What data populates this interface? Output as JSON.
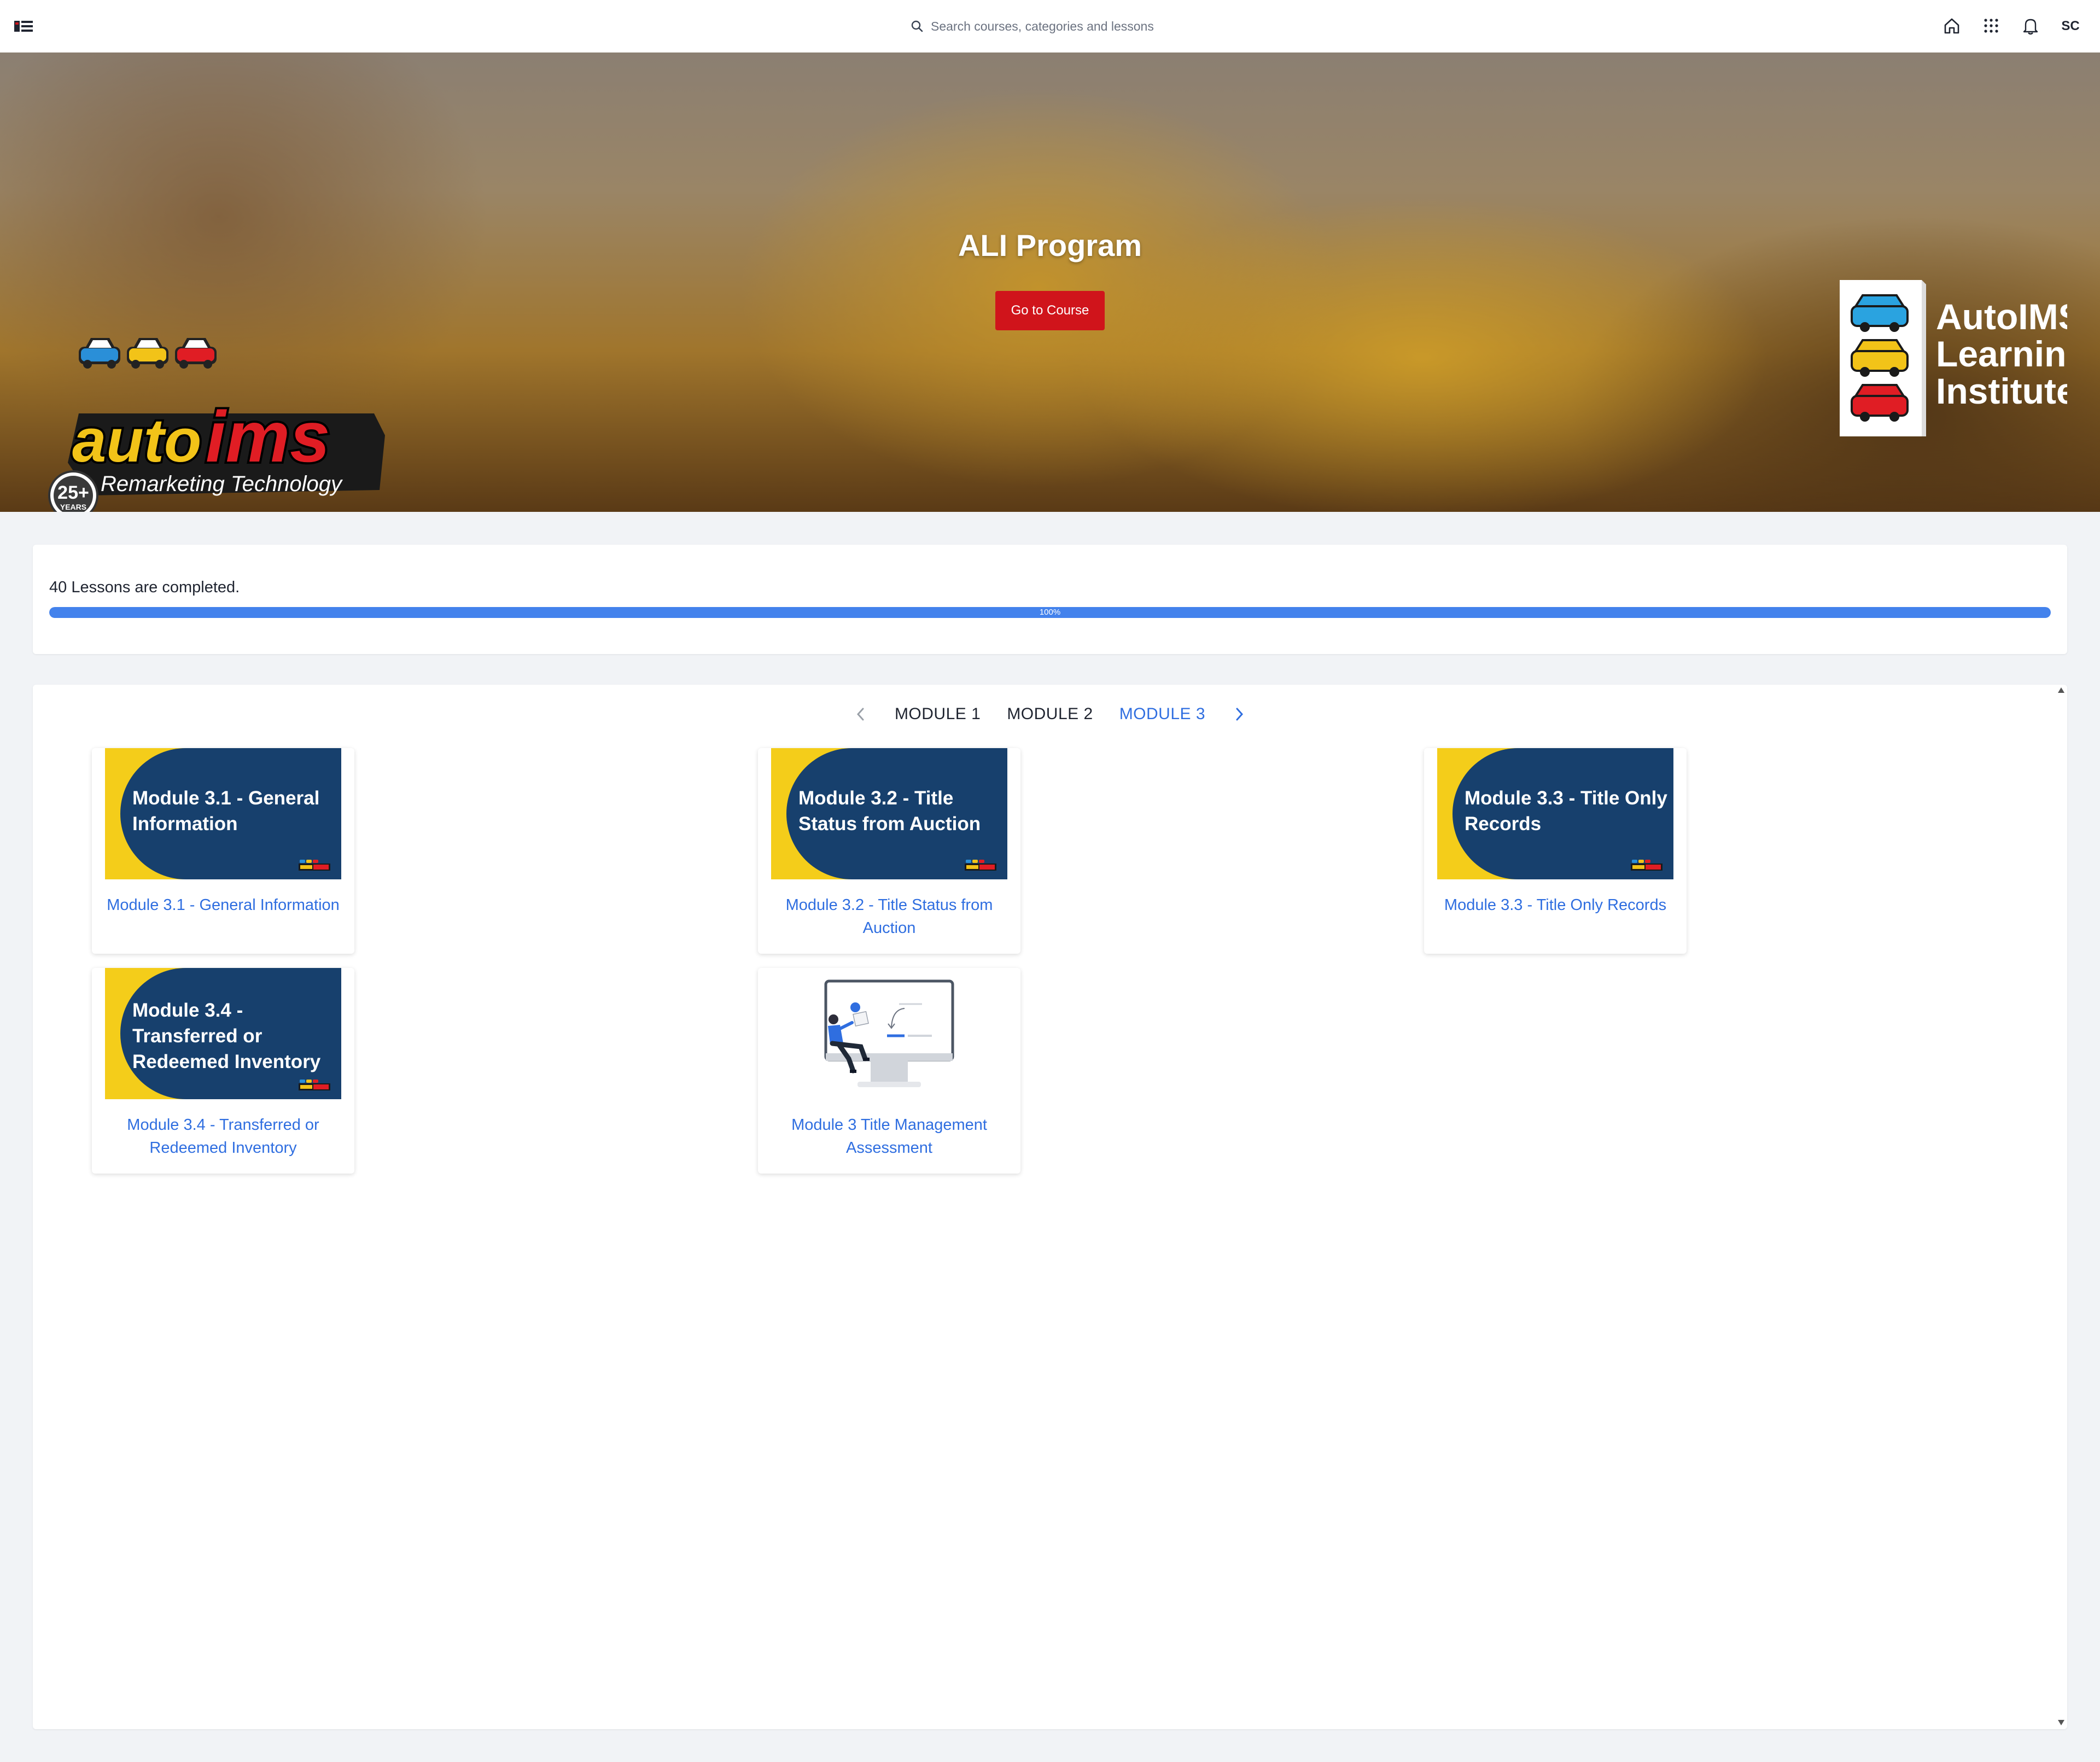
{
  "header": {
    "search_placeholder": "Search courses, categories and lessons",
    "avatar_initials": "SC",
    "icons": [
      "menu-icon",
      "search-icon",
      "home-icon",
      "apps-grid-icon",
      "bell-icon"
    ]
  },
  "hero": {
    "title": "ALI Program",
    "button_label": "Go to Course",
    "left_logo": {
      "word_auto": "auto",
      "word_ims": "ims",
      "tagline": "Remarketing Technology",
      "badge": "25+",
      "badge_sub": "YEARS"
    },
    "right_logo": {
      "line1": "AutoIMS",
      "line2": "Learning",
      "line3": "Institute"
    }
  },
  "progress": {
    "text": "40 Lessons are completed.",
    "percent": 100,
    "percent_label": "100%"
  },
  "modules": {
    "tabs": [
      "MODULE 1",
      "MODULE 2",
      "MODULE 3"
    ],
    "active_tab": "MODULE 3",
    "cards": [
      {
        "thumb_text": "Module 3.1 - General Information",
        "title": "Module 3.1 - General Information"
      },
      {
        "thumb_text": "Module 3.2 - Title Status from Auction",
        "title": "Module 3.2 - Title Status from Auction"
      },
      {
        "thumb_text": "Module 3.3 - Title Only Records",
        "title": "Module 3.3 - Title Only Records"
      },
      {
        "thumb_text": "Module 3.4 - Transferred or Redeemed Inventory",
        "title": "Module 3.4 - Transferred or Redeemed Inventory"
      },
      {
        "thumb_text": "",
        "title": "Module 3 Title Management Assessment"
      }
    ]
  },
  "colors": {
    "accent_blue": "#2f6ee0",
    "progress_blue": "#4382ec",
    "button_red": "#d0141b",
    "thumb_navy": "#17406d",
    "thumb_yellow": "#f4cd1a"
  }
}
